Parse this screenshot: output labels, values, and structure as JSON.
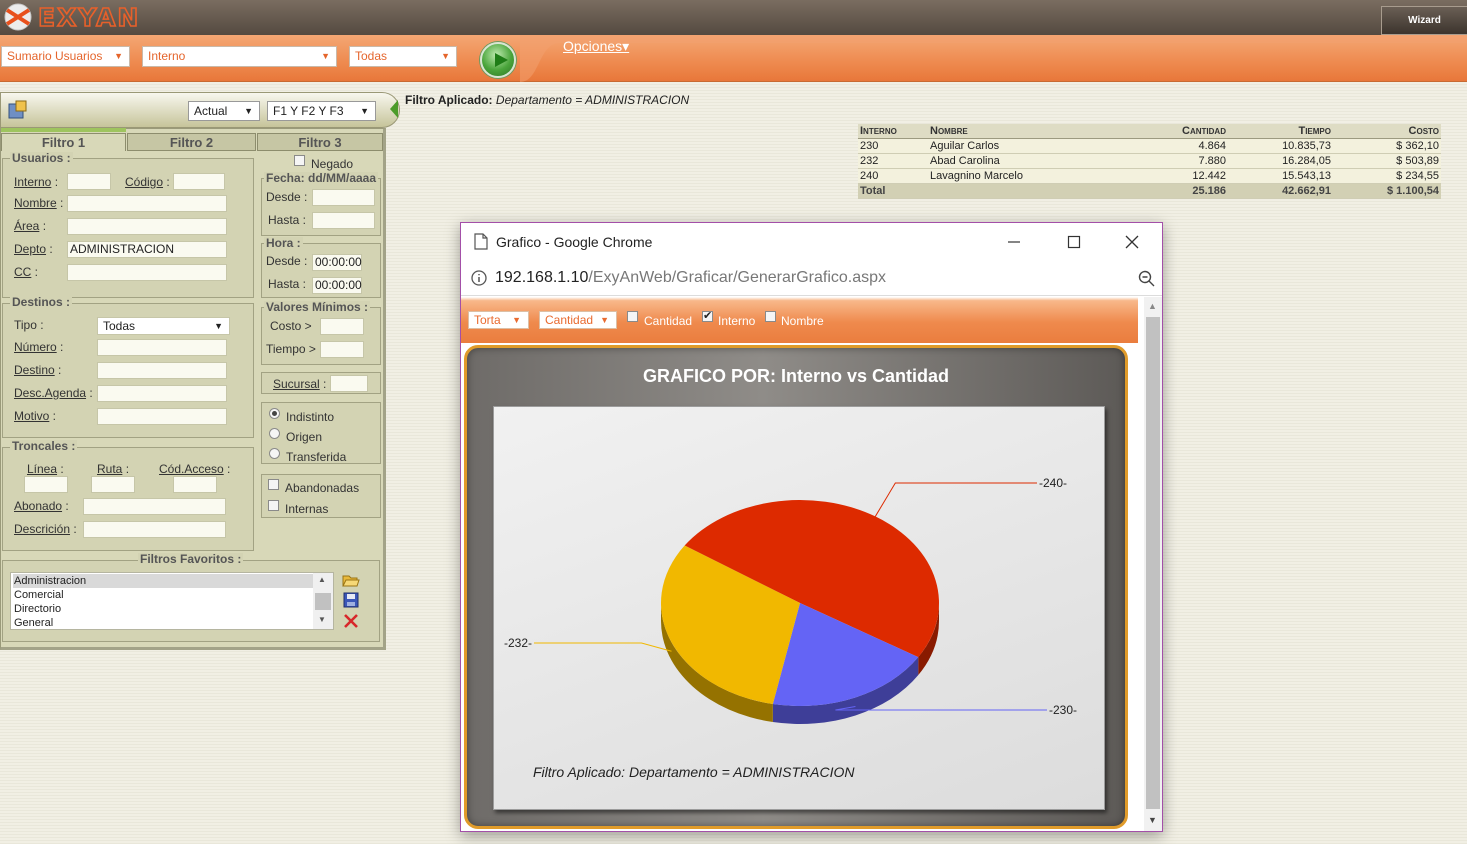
{
  "header": {
    "logo_text": "EXYAN",
    "wizard_label": "Wizard"
  },
  "toolbar": {
    "report_select": "Sumario Usuarios",
    "type_select": "Interno",
    "scope_select": "Todas",
    "options_label": "Opciones▾"
  },
  "filter_header": {
    "period_select": "Actual",
    "filters_select": "F1 Y F2 Y F3",
    "applied_label": "Filtro Aplicado:",
    "applied_value": "Departamento = ADMINISTRACION"
  },
  "tabs": [
    "Filtro 1",
    "Filtro 2",
    "Filtro 3"
  ],
  "usuarios": {
    "title": "Usuarios :",
    "interno": "Interno",
    "codigo": "Código",
    "nombre": "Nombre",
    "area": "Área",
    "depto": "Depto",
    "depto_value": "ADMINISTRACION",
    "cc": "CC"
  },
  "destinos": {
    "title": "Destinos :",
    "tipo": "Tipo :",
    "tipo_value": "Todas",
    "numero": "Número",
    "destino": "Destino",
    "desc_agenda": "Desc.Agenda",
    "motivo": "Motivo"
  },
  "troncales": {
    "title": "Troncales :",
    "linea": "Línea",
    "ruta": "Ruta",
    "cod_acceso": "Cód.Acceso",
    "abonado": "Abonado",
    "descricion": "Descrición"
  },
  "right_col": {
    "negado": "Negado",
    "fecha_title": "Fecha: dd/MM/aaaa",
    "desde": "Desde :",
    "hasta": "Hasta :",
    "hora_title": "Hora :",
    "hora_desde": "Desde :",
    "hora_hasta": "Hasta :",
    "hora_desde_value": "00:00:00",
    "hora_hasta_value": "00:00:00",
    "valores_title": "Valores Mínimos :",
    "costo": "Costo >",
    "tiempo": "Tiempo >",
    "sucursal": "Sucursal",
    "indistinto": "Indistinto",
    "origen": "Origen",
    "transferida": "Transferida",
    "abandonadas": "Abandonadas",
    "internas": "Internas"
  },
  "favoritos": {
    "title": "Filtros Favoritos :",
    "items": [
      "Administracion",
      "Comercial",
      "Directorio",
      "General"
    ]
  },
  "results": {
    "headers": [
      "Interno",
      "Nombre",
      "Cantidad",
      "Tiempo",
      "Costo"
    ],
    "rows": [
      [
        "230",
        "Aguilar Carlos",
        "4.864",
        "10.835,73",
        "$ 362,10"
      ],
      [
        "232",
        "Abad Carolina",
        "7.880",
        "16.284,05",
        "$ 503,89"
      ],
      [
        "240",
        "Lavagnino Marcelo",
        "12.442",
        "15.543,13",
        "$ 234,55"
      ]
    ],
    "total": [
      "Total",
      "",
      "25.186",
      "42.662,91",
      "$ 1.100,54"
    ]
  },
  "popup": {
    "title": "Grafico - Google Chrome",
    "url_host": "192.168.1.10",
    "url_path": "/ExyAnWeb/Graficar/GenerarGrafico.aspx",
    "chart_type_select": "Torta",
    "value_select": "Cantidad",
    "chk_cantidad": "Cantidad",
    "chk_interno": "Interno",
    "chk_nombre": "Nombre",
    "chart_title": "GRAFICO POR: Interno vs Cantidad",
    "chart_footer": "Filtro Aplicado:  Departamento = ADMINISTRACION"
  },
  "colors": {
    "accent": "#ee8a4f",
    "slice_240": "#dd2a00",
    "slice_232": "#f1b800",
    "slice_230": "#6464f5"
  },
  "chart_data": {
    "type": "pie",
    "title": "GRAFICO POR: Interno vs Cantidad",
    "categories": [
      "240",
      "230",
      "232"
    ],
    "values": [
      12442,
      4864,
      7880
    ],
    "labels": [
      "-240-",
      "-230-",
      "-232-"
    ],
    "colors": [
      "#dd2a00",
      "#6464f5",
      "#f1b800"
    ]
  }
}
